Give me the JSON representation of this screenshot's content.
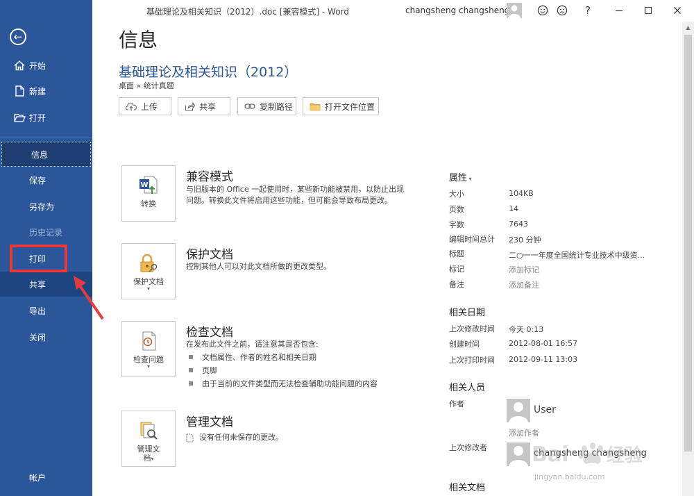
{
  "window": {
    "title": "基础理论及相关知识（2012）.doc [兼容模式] - Word",
    "user_name": "changsheng changsheng",
    "icons": [
      "smile-icon",
      "frown-icon",
      "help-icon",
      "minimize-icon",
      "maximize-icon",
      "close-icon"
    ],
    "help_glyph": "?"
  },
  "sidebar": {
    "bg_color": "#2b579a",
    "top_items": [
      {
        "label": "开始",
        "icon": "home-icon"
      },
      {
        "label": "新建",
        "icon": "new-doc-icon"
      },
      {
        "label": "打开",
        "icon": "open-folder-icon"
      }
    ],
    "items": [
      {
        "label": "信息",
        "state": "active"
      },
      {
        "label": "保存",
        "state": "normal"
      },
      {
        "label": "另存为",
        "state": "normal"
      },
      {
        "label": "历史记录",
        "state": "disabled"
      },
      {
        "label": "打印",
        "state": "highlighted"
      },
      {
        "label": "共享",
        "state": "hover"
      },
      {
        "label": "导出",
        "state": "normal"
      },
      {
        "label": "关闭",
        "state": "normal"
      }
    ],
    "account_label": "帐户"
  },
  "main": {
    "page_title": "信息",
    "doc_title": "基础理论及相关知识（2012）",
    "breadcrumb": "桌面 » 统计真题",
    "actions": [
      {
        "label": "上传",
        "icon": "upload-icon"
      },
      {
        "label": "共享",
        "icon": "share-icon"
      },
      {
        "label": "复制路径",
        "icon": "link-icon"
      },
      {
        "label": "打开文件位置",
        "icon": "folder-icon"
      }
    ],
    "sections": [
      {
        "tile_label": "转换",
        "heading": "兼容模式",
        "desc": "与旧版本的 Office 一起使用时，某些新功能被禁用，以防止出现问题。转换此文件将启用这些功能，但可能会导致布局更改。"
      },
      {
        "tile_label": "保护文档",
        "heading": "保护文档",
        "desc": "控制其他人可以对此文档所做的更改类型。"
      },
      {
        "tile_label": "检查问题",
        "heading": "检查文档",
        "desc": "在发布此文件之前，请注意其是否包含:",
        "bullets": [
          "文档属性、作者的姓名和相关日期",
          "页脚",
          "由于当前的文件类型而无法检查辅助功能问题的内容"
        ]
      },
      {
        "tile_label_1": "管理文",
        "tile_label_2": "档",
        "heading": "管理文档",
        "desc": "没有任何未保存的更改。"
      }
    ]
  },
  "properties": {
    "heading": "属性",
    "rows": [
      {
        "key": "大小",
        "value": "104KB"
      },
      {
        "key": "页数",
        "value": "14"
      },
      {
        "key": "字数",
        "value": "7643"
      },
      {
        "key": "编辑时间总计",
        "value": "230 分钟"
      },
      {
        "key": "标题",
        "value": "二○一一年度全国统计专业技术中级资..."
      },
      {
        "key": "标记",
        "value": "添加标记"
      },
      {
        "key": "备注",
        "value": "添加备注"
      }
    ],
    "dates_heading": "相关日期",
    "dates": [
      {
        "key": "上次修改时间",
        "value": "今天 0:13"
      },
      {
        "key": "创建时间",
        "value": "2012-08-01 16:57"
      },
      {
        "key": "上次打印时间",
        "value": "2012-09-11 13:03"
      }
    ],
    "people_heading": "相关人员",
    "author_key": "作者",
    "author_name": "User",
    "add_author": "添加作者",
    "last_modified_key": "上次修改者",
    "last_modified_name": "changsheng changsheng",
    "docs_heading": "相关文档"
  },
  "watermark": {
    "text": "Baidu经验",
    "url": "jingyan.baidu.com"
  },
  "colors": {
    "accent": "#2b579a",
    "highlight_red": "#e83a3a"
  }
}
